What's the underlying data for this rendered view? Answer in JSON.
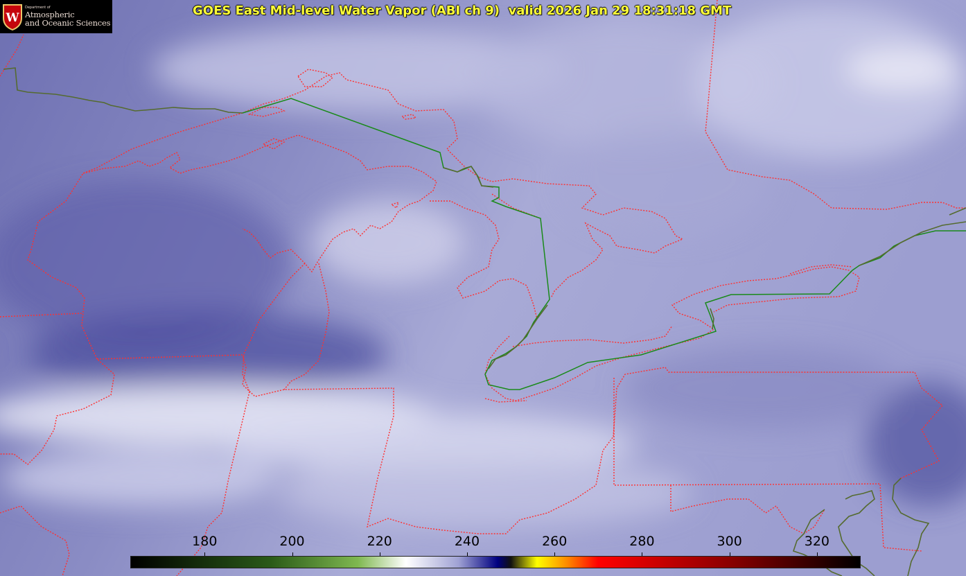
{
  "title": "GOES East Mid-level Water Vapor (ABI ch 9)  valid 2026 Jan 29 18:31:18 GMT",
  "logo": {
    "dept": "Department of",
    "line1": "Atmospheric",
    "line2": "and Oceanic Sciences",
    "letter": "W"
  },
  "colorbar": {
    "min": 163,
    "max": 330,
    "ticks": [
      {
        "value": 180,
        "label": "180"
      },
      {
        "value": 200,
        "label": "200"
      },
      {
        "value": 220,
        "label": "220"
      },
      {
        "value": 240,
        "label": "240"
      },
      {
        "value": 260,
        "label": "260"
      },
      {
        "value": 280,
        "label": "280"
      },
      {
        "value": 300,
        "label": "300"
      },
      {
        "value": 320,
        "label": "320"
      }
    ],
    "stops": [
      {
        "value": 163,
        "color": "#000000"
      },
      {
        "value": 195,
        "color": "#2a5a18"
      },
      {
        "value": 215,
        "color": "#7fb850"
      },
      {
        "value": 226,
        "color": "#ffffff"
      },
      {
        "value": 238,
        "color": "#a0a2d4"
      },
      {
        "value": 247,
        "color": "#000080"
      },
      {
        "value": 250,
        "color": "#111111"
      },
      {
        "value": 256,
        "color": "#ffff00"
      },
      {
        "value": 263,
        "color": "#ff8800"
      },
      {
        "value": 270,
        "color": "#ff0000"
      },
      {
        "value": 300,
        "color": "#8b0000"
      },
      {
        "value": 330,
        "color": "#000000"
      }
    ]
  },
  "colors": {
    "state_borders": "#ff3030",
    "country_border": "#1a8a1a",
    "coastline": "#556b2f",
    "title": "#ffff38"
  }
}
